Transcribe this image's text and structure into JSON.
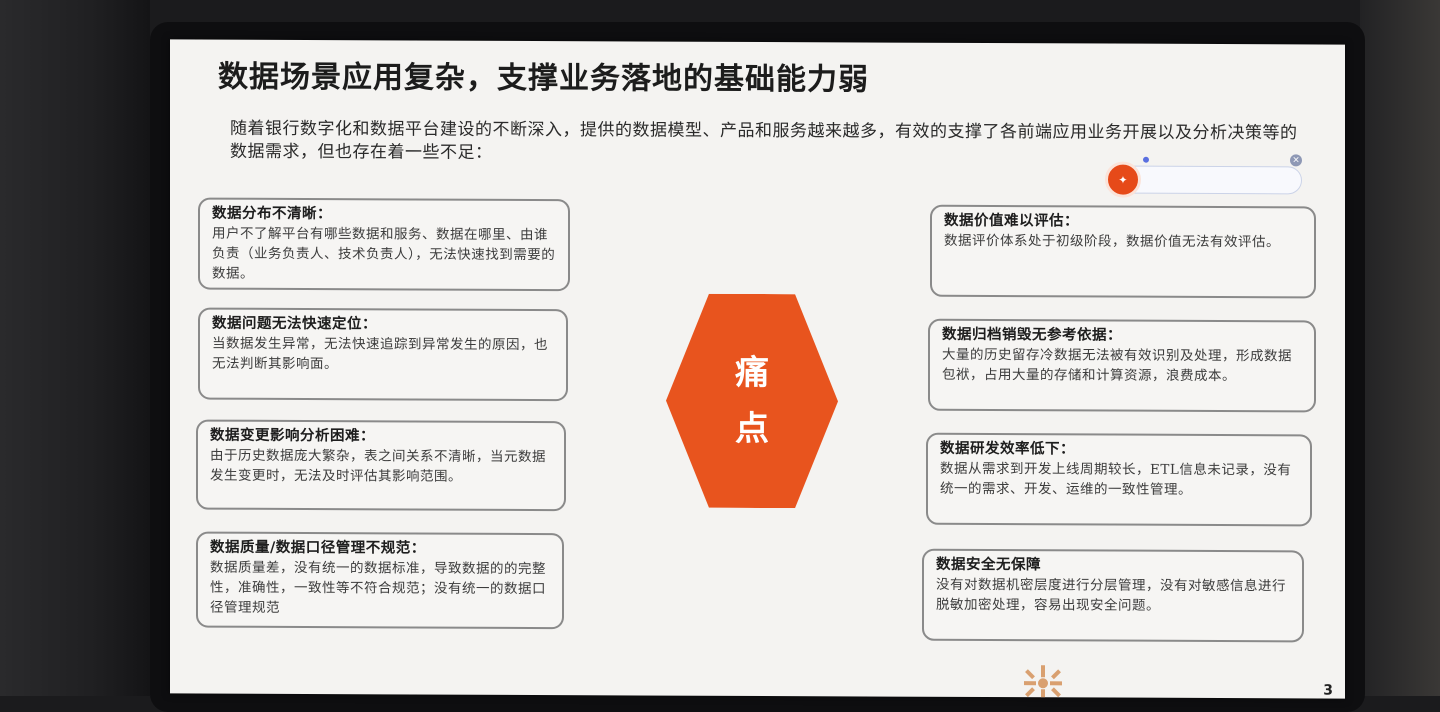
{
  "slide": {
    "title": "数据场景应用复杂，支撑业务落地的基础能力弱",
    "intro": "随着银行数字化和数据平台建设的不断深入，提供的数据模型、产品和服务越来越多，有效的支撑了各前端应用业务开展以及分析决策等的数据需求，但也存在着一些不足：",
    "page_number": "3"
  },
  "center": {
    "line1": "痛",
    "line2": "点",
    "color": "#e8541e"
  },
  "left_cards": [
    {
      "title": "数据分布不清晰：",
      "body": "用户不了解平台有哪些数据和服务、数据在哪里、由谁负责（业务负责人、技术负责人），无法快速找到需要的数据。"
    },
    {
      "title": "数据问题无法快速定位：",
      "body": "当数据发生异常，无法快速追踪到异常发生的原因，也无法判断其影响面。"
    },
    {
      "title": "数据变更影响分析困难：",
      "body": "由于历史数据庞大繁杂，表之间关系不清晰，当元数据发生变更时，无法及时评估其影响范围。"
    },
    {
      "title": "数据质量/数据口径管理不规范：",
      "body": "数据质量差，没有统一的数据标准，导致数据的的完整性，准确性，一致性等不符合规范；没有统一的数据口径管理规范"
    }
  ],
  "right_cards": [
    {
      "title": "数据价值难以评估：",
      "body": "数据评价体系处于初级阶段，数据价值无法有效评估。"
    },
    {
      "title": "数据归档销毁无参考依据：",
      "body": "大量的历史留存冷数据无法被有效识别及处理，形成数据包袱，占用大量的存储和计算资源，浪费成本。"
    },
    {
      "title": "数据研发效率低下：",
      "body": "数据从需求到开发上线周期较长，ETL信息未记录，没有统一的需求、开发、运维的一致性管理。"
    },
    {
      "title": "数据安全无保障",
      "body": "没有对数据机密层度进行分层管理，没有对敏感信息进行脱敏加密处理，容易出现安全问题。"
    }
  ],
  "search_widget": {
    "icon": "search-logo-icon",
    "close_icon": "close-icon"
  }
}
